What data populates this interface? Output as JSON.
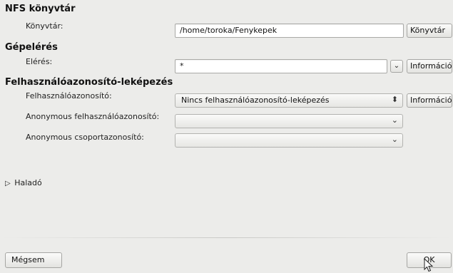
{
  "nfs": {
    "title": "NFS könyvtár",
    "dir_label": "Könyvtár:",
    "dir_value": "/home/toroka/Fenykepek",
    "browse_button": "Könyvtár"
  },
  "access": {
    "title": "Gépelérés",
    "label": "Elérés:",
    "value": "*",
    "info_button": "Információ"
  },
  "mapping": {
    "title": "Felhasználóazonosító-leképezés",
    "uid_label": "Felhasználóazonosító:",
    "uid_value": "Nincs felhasználóazonosító-leképezés",
    "info_button": "Információ",
    "anon_uid_label": "Anonymous felhasználóazonosító:",
    "anon_uid_value": "",
    "anon_gid_label": "Anonymous csoportazonosító:",
    "anon_gid_value": ""
  },
  "advanced": {
    "label": "Haladó"
  },
  "footer": {
    "cancel": "Mégsem",
    "ok": "OK"
  },
  "icons": {
    "dropdown": "chevron-down-icon",
    "spin": "up-down-icon",
    "expander": "triangle-right-icon",
    "cursor": "mouse-pointer-icon"
  }
}
